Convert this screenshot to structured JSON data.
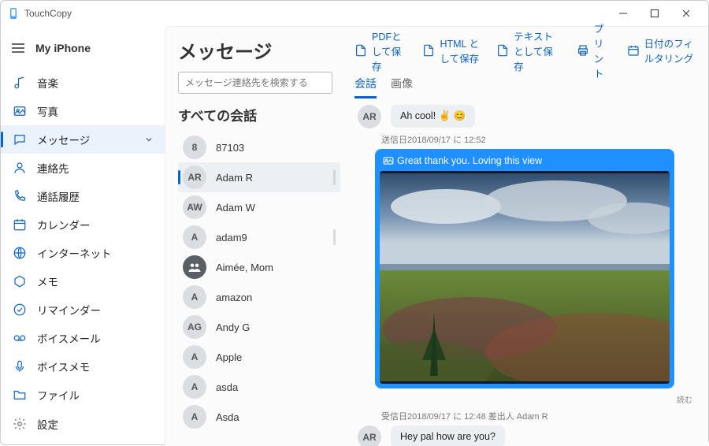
{
  "app": {
    "title": "TouchCopy"
  },
  "sidebar": {
    "device": "My iPhone",
    "items": [
      {
        "key": "music",
        "label": "音楽"
      },
      {
        "key": "photos",
        "label": "写真"
      },
      {
        "key": "messages",
        "label": "メッセージ"
      },
      {
        "key": "contacts",
        "label": "連絡先"
      },
      {
        "key": "callhistory",
        "label": "通話履歴"
      },
      {
        "key": "calendar",
        "label": "カレンダー"
      },
      {
        "key": "internet",
        "label": "インターネット"
      },
      {
        "key": "notes",
        "label": "メモ"
      },
      {
        "key": "reminders",
        "label": "リマインダー"
      },
      {
        "key": "voicemail",
        "label": "ボイスメール"
      },
      {
        "key": "voicememo",
        "label": "ボイスメモ"
      },
      {
        "key": "files",
        "label": "ファイル"
      }
    ],
    "bottom": {
      "key": "settings",
      "label": "設定"
    }
  },
  "page": {
    "title": "メッセージ",
    "toolbar": {
      "pdf": "PDFとして保存",
      "html": "HTML として保存",
      "text": "テキストとして保存",
      "print": "プリント",
      "datefilter": "日付のフィルタリング"
    },
    "search_placeholder": "メッセージ連絡先を検索する",
    "section": "すべての会話",
    "tabs": {
      "conversation": "会話",
      "images": "画像"
    }
  },
  "conversations": [
    {
      "initials": "8",
      "name": "87103"
    },
    {
      "initials": "AR",
      "name": "Adam R",
      "selected": true
    },
    {
      "initials": "AW",
      "name": "Adam W"
    },
    {
      "initials": "A",
      "name": "adam9"
    },
    {
      "initials": "",
      "name": "Aimée, Mom",
      "group": true
    },
    {
      "initials": "A",
      "name": "amazon"
    },
    {
      "initials": "AG",
      "name": "Andy G"
    },
    {
      "initials": "A",
      "name": "Apple"
    },
    {
      "initials": "A",
      "name": "asda"
    },
    {
      "initials": "A",
      "name": "Asda"
    }
  ],
  "thread": {
    "top": {
      "avatar": "AR",
      "text": "Ah cool! ✌️ 😊"
    },
    "sent_meta": "送信日2018/09/17 に 12:52",
    "sent_caption": "Great thank you. Loving this view",
    "read": "読む",
    "recv_meta": "受信日2018/09/17 に 12:48 差出人 Adam R",
    "recv": {
      "avatar": "AR",
      "text": "Hey pal how are you?"
    }
  }
}
